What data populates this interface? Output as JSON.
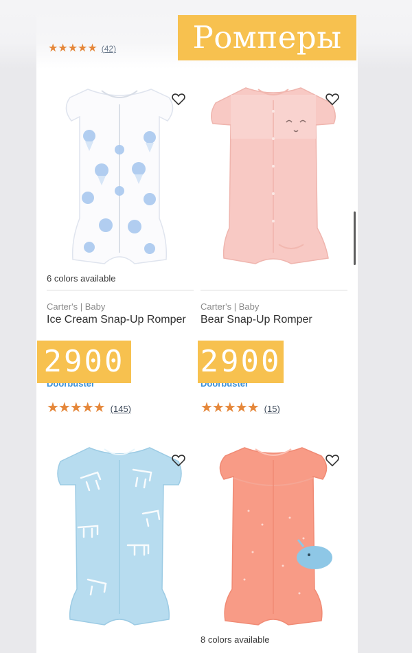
{
  "banner": {
    "title": "Ромперы"
  },
  "top_rating": {
    "stars": "★★★★★",
    "count": "(42)"
  },
  "products": [
    {
      "colors": "6 colors available",
      "brand": "Carter's | Baby",
      "name": "Ice Cream Snap-Up Romper",
      "price": "2900",
      "badge": "Doorbuster",
      "stars": "★★★★★",
      "rating_count": "(145)",
      "image": "romper-ice-cream-white"
    },
    {
      "brand": "Carter's | Baby",
      "name": "Bear Snap-Up Romper",
      "price": "2900",
      "badge": "Doorbuster",
      "stars": "★★★★★",
      "rating_count": "(15)",
      "image": "romper-bear-pink"
    },
    {
      "image": "romper-cat-blue"
    },
    {
      "colors": "8 colors available",
      "image": "romper-whale-coral"
    }
  ],
  "icons": {
    "favorite": "heart-outline-icon",
    "rating": "star-icon"
  },
  "colors": {
    "highlight": "#f7c14f",
    "star": "#e5873a",
    "link": "#3a8fd8"
  }
}
